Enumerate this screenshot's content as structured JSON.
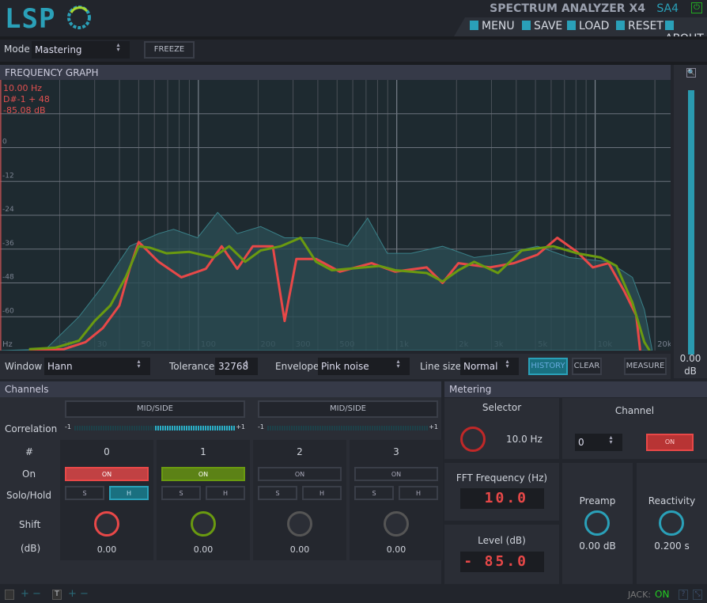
{
  "header": {
    "logo": "LSP",
    "title": "SPECTRUM ANALYZER X4",
    "short": "SA4",
    "menu": [
      {
        "label": "MENU",
        "icon": "menu-icon"
      },
      {
        "label": "SAVE",
        "icon": "save-icon"
      },
      {
        "label": "LOAD",
        "icon": "load-icon"
      },
      {
        "label": "RESET",
        "icon": "reset-icon"
      },
      {
        "label": "ABOUT",
        "icon": "about-icon"
      }
    ]
  },
  "toolbar": {
    "mode_label": "Mode",
    "mode_value": "Mastering",
    "freeze": "FREEZE"
  },
  "graph": {
    "title": "FREQUENCY GRAPH",
    "readout": [
      "10.00 Hz",
      "D#-1 + 48",
      "-85.08 dB"
    ],
    "y_unit": "dB",
    "x_unit": "Hz",
    "y_ticks": [
      "0",
      "-12",
      "-24",
      "-36",
      "-48",
      "-60"
    ],
    "x_ticks": [
      "20",
      "30",
      "50",
      "100",
      "200",
      "300",
      "500",
      "1k",
      "2k",
      "3k",
      "5k",
      "10k",
      "20k"
    ],
    "meter_value": "0.00",
    "meter_unit": "dB",
    "meter_level_db": 0
  },
  "chart_data": {
    "type": "line",
    "xlabel": "Hz",
    "ylabel": "dB",
    "x_scale": "log",
    "xlim": [
      10,
      24000
    ],
    "ylim": [
      -72,
      24
    ],
    "grid": true,
    "series": [
      {
        "color": "#e84848",
        "points": [
          [
            14,
            -72
          ],
          [
            21,
            -71.5
          ],
          [
            27,
            -69
          ],
          [
            33,
            -64
          ],
          [
            40,
            -56
          ],
          [
            45,
            -43
          ],
          [
            50,
            -33.5
          ],
          [
            63,
            -40.5
          ],
          [
            82,
            -46
          ],
          [
            109,
            -43
          ],
          [
            131,
            -35
          ],
          [
            157,
            -43
          ],
          [
            188,
            -35
          ],
          [
            237,
            -35
          ],
          [
            272,
            -61.5
          ],
          [
            312,
            -39.5
          ],
          [
            392,
            -39.5
          ],
          [
            516,
            -44
          ],
          [
            746,
            -41
          ],
          [
            982,
            -44
          ],
          [
            1416,
            -42.5
          ],
          [
            1700,
            -48
          ],
          [
            2046,
            -41
          ],
          [
            2951,
            -42.5
          ],
          [
            3890,
            -41
          ],
          [
            5117,
            -38
          ],
          [
            6440,
            -32
          ],
          [
            8100,
            -37
          ],
          [
            9730,
            -42.5
          ],
          [
            11690,
            -41
          ],
          [
            14030,
            -51
          ],
          [
            16100,
            -59.5
          ],
          [
            16860,
            -72
          ]
        ]
      },
      {
        "color": "#6a9a10",
        "points": [
          [
            14,
            -71.5
          ],
          [
            19,
            -71
          ],
          [
            25,
            -68.5
          ],
          [
            30,
            -61.5
          ],
          [
            36,
            -56
          ],
          [
            43,
            -46
          ],
          [
            50,
            -35
          ],
          [
            57,
            -35.5
          ],
          [
            69,
            -37.5
          ],
          [
            90,
            -37
          ],
          [
            119,
            -39
          ],
          [
            143,
            -35
          ],
          [
            172,
            -40.5
          ],
          [
            206,
            -36.5
          ],
          [
            260,
            -35
          ],
          [
            327,
            -32
          ],
          [
            392,
            -40.5
          ],
          [
            471,
            -43.5
          ],
          [
            566,
            -43
          ],
          [
            817,
            -42
          ],
          [
            982,
            -43.5
          ],
          [
            1416,
            -44.5
          ],
          [
            1700,
            -47.5
          ],
          [
            2046,
            -43.5
          ],
          [
            2455,
            -40.5
          ],
          [
            3236,
            -44.5
          ],
          [
            4266,
            -36.5
          ],
          [
            6150,
            -35
          ],
          [
            8100,
            -37.5
          ],
          [
            10660,
            -39
          ],
          [
            12800,
            -42
          ],
          [
            15400,
            -55
          ],
          [
            17700,
            -69
          ],
          [
            18800,
            -72
          ]
        ]
      },
      {
        "color": "#2a6068",
        "fill": true,
        "points": [
          [
            10,
            -72
          ],
          [
            17,
            -71.5
          ],
          [
            25,
            -60
          ],
          [
            33,
            -49
          ],
          [
            45,
            -35
          ],
          [
            63,
            -30.5
          ],
          [
            75,
            -29
          ],
          [
            99,
            -32
          ],
          [
            125,
            -23
          ],
          [
            157,
            -30.5
          ],
          [
            206,
            -28
          ],
          [
            272,
            -32
          ],
          [
            392,
            -32
          ],
          [
            566,
            -35
          ],
          [
            713,
            -25
          ],
          [
            895,
            -37.5
          ],
          [
            1180,
            -37.5
          ],
          [
            1700,
            -35
          ],
          [
            2455,
            -39
          ],
          [
            3548,
            -37.5
          ],
          [
            5117,
            -35
          ],
          [
            7400,
            -39
          ],
          [
            11690,
            -40.5
          ],
          [
            15400,
            -46
          ],
          [
            17700,
            -57.5
          ],
          [
            19400,
            -72
          ]
        ]
      }
    ]
  },
  "controls": {
    "window_label": "Window",
    "window_value": "Hann",
    "tolerance_label": "Tolerance",
    "tolerance_value": "32768",
    "envelope_label": "Envelope",
    "envelope_value": "Pink noise",
    "linesize_label": "Line size",
    "linesize_value": "Normal",
    "history": "HISTORY",
    "clear": "CLEAR",
    "measure": "MEASURE"
  },
  "channels": {
    "title": "Channels",
    "row_labels": [
      "Correlation",
      "#",
      "On",
      "Solo/Hold",
      "Shift",
      "(dB)"
    ],
    "midside": [
      "MID/SIDE",
      "MID/SIDE"
    ],
    "corr_min": "-1",
    "corr_max": "+1",
    "items": [
      {
        "num": "0",
        "on": "ON",
        "s": "S",
        "h": "H",
        "shift": "0.00",
        "color": "#e84848",
        "active": true,
        "hold": true
      },
      {
        "num": "1",
        "on": "ON",
        "s": "S",
        "h": "H",
        "shift": "0.00",
        "color": "#6a9a10",
        "active": true,
        "hold": false
      },
      {
        "num": "2",
        "on": "ON",
        "s": "S",
        "h": "H",
        "shift": "0.00",
        "color": "#3a4a50",
        "active": false,
        "hold": false
      },
      {
        "num": "3",
        "on": "ON",
        "s": "S",
        "h": "H",
        "shift": "0.00",
        "color": "#4a4c54",
        "active": false,
        "hold": false
      }
    ]
  },
  "metering": {
    "title": "Metering",
    "selector_label": "Selector",
    "selector_value": "10.0 Hz",
    "channel_label": "Channel",
    "channel_value": "0",
    "channel_on": "ON",
    "fft_label": "FFT Frequency (Hz)",
    "fft_value": "10.0",
    "level_label": "Level (dB)",
    "level_sign": "-",
    "level_value": "85.0",
    "preamp_label": "Preamp",
    "preamp_value": "0.00 dB",
    "reactivity_label": "Reactivity",
    "reactivity_value": "0.200 s"
  },
  "footer": {
    "jack_label": "JACK:",
    "jack_value": "ON"
  }
}
